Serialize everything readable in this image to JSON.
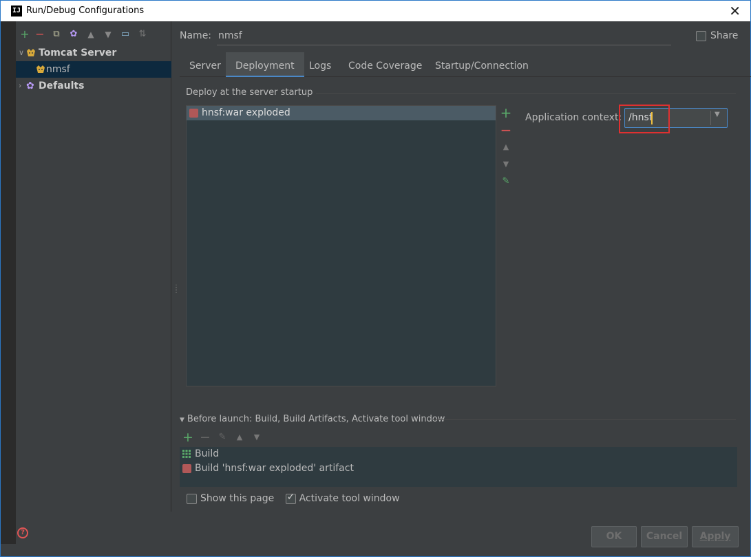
{
  "window": {
    "title": "Run/Debug Configurations",
    "app_icon": "IJ",
    "close_icon": "✕"
  },
  "left_toolbar": {
    "icons": [
      {
        "name": "add-icon",
        "glyph": "+",
        "color": "#59a869"
      },
      {
        "name": "remove-icon",
        "glyph": "−",
        "color": "#e05555"
      },
      {
        "name": "copy-icon",
        "glyph": "⧉",
        "color": "#c0c0a0"
      },
      {
        "name": "settings-icon",
        "glyph": "✿",
        "color": "#b99bf8"
      },
      {
        "name": "move-up-icon",
        "glyph": "🡑",
        "color": "#888888"
      },
      {
        "name": "move-down-icon",
        "glyph": "🡓",
        "color": "#888888"
      },
      {
        "name": "folder-icon",
        "glyph": "▭",
        "color": "#8ab8d6"
      },
      {
        "name": "sort-icon",
        "glyph": "⇅",
        "color": "#888888"
      }
    ]
  },
  "tree": {
    "items": [
      {
        "label": "Tomcat Server",
        "icon": "tomcat-icon"
      },
      {
        "label": "nmsf",
        "icon": "tomcat-icon"
      },
      {
        "label": "Defaults",
        "icon": "gear-icon"
      }
    ]
  },
  "form": {
    "name_label": "Name:",
    "name_value": "nmsf",
    "share_label": "Share"
  },
  "tabs": [
    "Server",
    "Deployment",
    "Logs",
    "Code Coverage",
    "Startup/Connection"
  ],
  "deployment": {
    "section_label": "Deploy at the server startup",
    "items": [
      "hnsf:war exploded"
    ],
    "context_label": "Application context:",
    "context_value": "/hnsf"
  },
  "before_launch": {
    "label": "Before launch: Build, Build Artifacts, Activate tool window",
    "items": [
      "Build",
      "Build 'hnsf:war exploded' artifact"
    ],
    "show_page_label": "Show this page",
    "activate_label": "Activate tool window"
  },
  "buttons": {
    "ok": "OK",
    "cancel": "Cancel",
    "apply": "Apply",
    "help": "?"
  },
  "colors": {
    "accent": "#4a88c7",
    "highlight": "#e03030",
    "add": "#59a869",
    "remove": "#e05555"
  }
}
